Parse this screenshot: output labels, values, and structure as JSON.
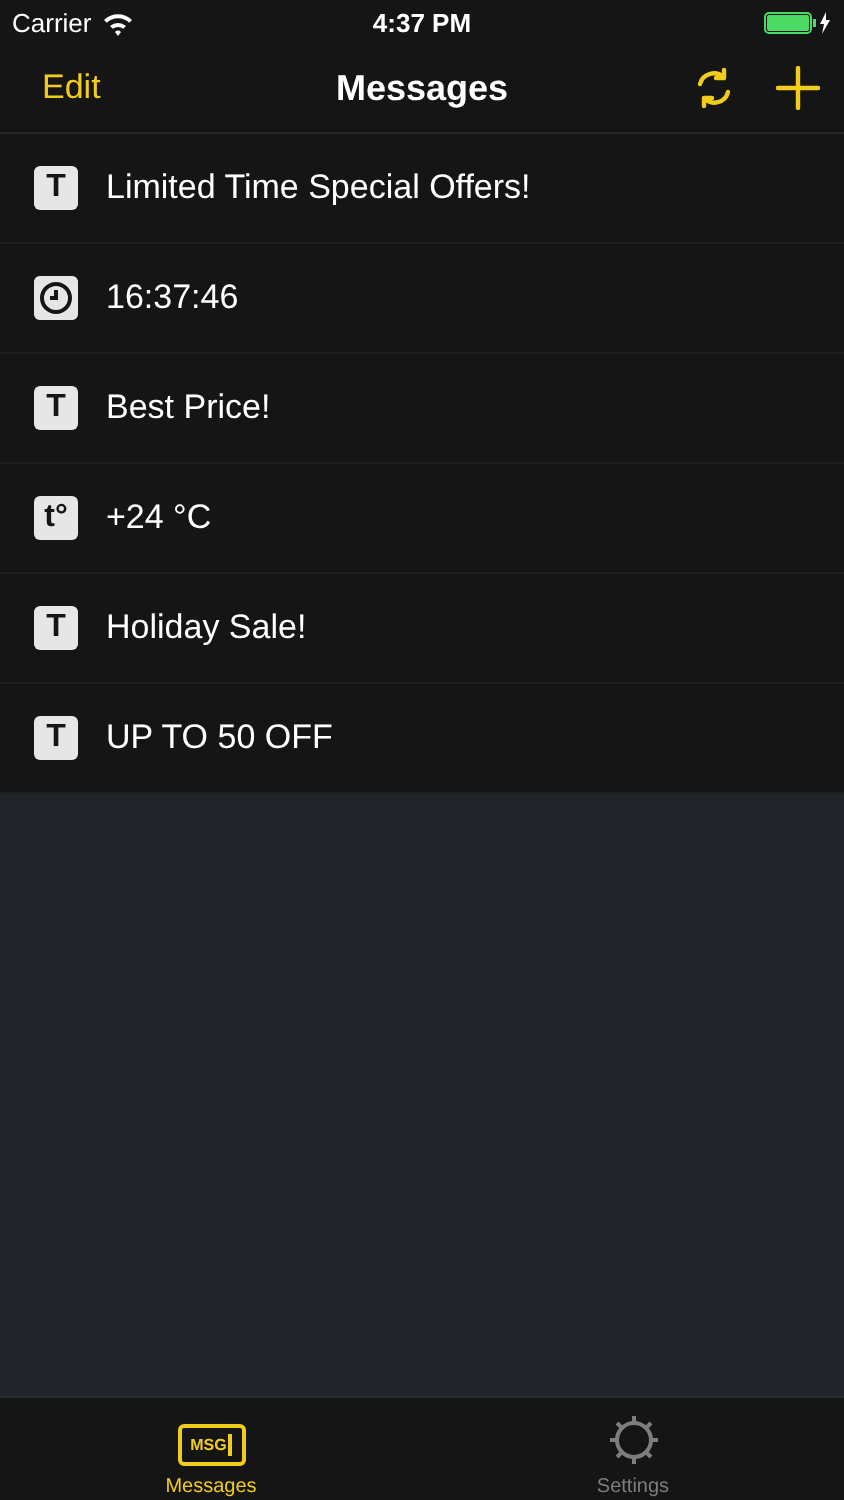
{
  "status_bar": {
    "carrier": "Carrier",
    "time": "4:37 PM"
  },
  "nav": {
    "left": "Edit",
    "title": "Messages"
  },
  "messages": [
    {
      "kind": "text",
      "badge": "T",
      "text": "Limited Time Special Offers!"
    },
    {
      "kind": "clock",
      "text": "16:37:46"
    },
    {
      "kind": "text",
      "badge": "T",
      "text": "Best Price!"
    },
    {
      "kind": "temperature",
      "badge": "t°",
      "text": "+24 °C"
    },
    {
      "kind": "text",
      "badge": "T",
      "text": "Holiday Sale!"
    },
    {
      "kind": "text",
      "badge": "T",
      "text": "UP TO 50 OFF"
    }
  ],
  "tabs": [
    {
      "kind": "messages",
      "icon_text": "MSG",
      "label": "Messages",
      "selected": true
    },
    {
      "kind": "settings",
      "label": "Settings",
      "selected": false
    }
  ]
}
